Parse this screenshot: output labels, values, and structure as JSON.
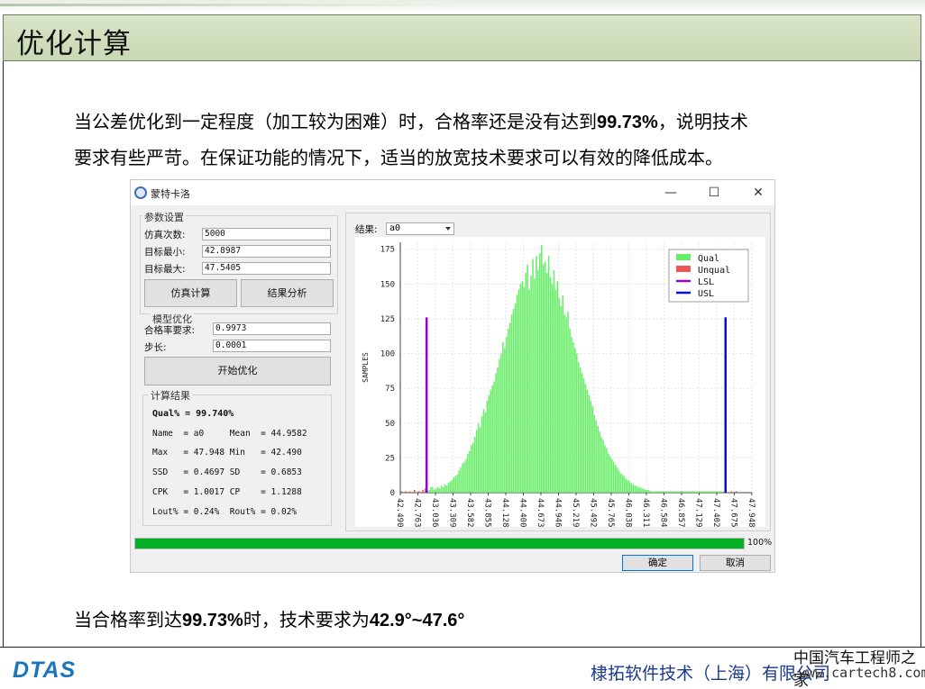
{
  "slide": {
    "title": "优化计算",
    "para1_line1_pre": "当公差优化到一定程度（加工较为困难）时，合格率还是没有达到",
    "para1_line1_bold": "99.73%",
    "para1_line1_post": "，说明技术",
    "para1_line2": "要求有些严苛。在保证功能的情况下，适当的放宽技术要求可以有效的降低成本。",
    "conc_pre": "当合格率到达",
    "conc_b1": "99.73%",
    "conc_mid": "时，技术要求为",
    "conc_b2": "42.9°~47.6°",
    "company": "棣拓软件技术（上海）有限公司",
    "logo": "DTAS",
    "watermark_line1": "中国汽车工程师之家",
    "watermark_line2": "www.cartech8.com"
  },
  "window": {
    "title": "蒙特卡洛",
    "minimize": "—",
    "maximize": "☐",
    "close": "✕",
    "params": {
      "group_label": "参数设置",
      "sim_count_label": "仿真次数:",
      "sim_count_value": "5000",
      "target_min_label": "目标最小:",
      "target_min_value": "42.8987",
      "target_max_label": "目标最大:",
      "target_max_value": "47.5405",
      "simulate_button": "仿真计算",
      "analyze_button": "结果分析"
    },
    "optimize": {
      "group_label": "模型优化",
      "qual_req_label": "合格率要求:",
      "qual_req_value": "0.9973",
      "step_label": "步长:",
      "step_value": "0.0001",
      "start_button": "开始优化"
    },
    "results": {
      "group_label": "计算结果",
      "qual_line": "Qual% = 99.740%",
      "rows": [
        "Name  = a0     Mean  = 44.9582",
        "Max   = 47.948 Min   = 42.490",
        "SSD   = 0.4697 SD    = 0.6853",
        "CPK   = 1.0017 CP    = 1.1288",
        "Lout% = 0.24%  Rout% = 0.02%"
      ]
    },
    "result_select_label": "结果:",
    "result_select_value": "a0",
    "progress": {
      "value": 1.0,
      "label": "100%"
    },
    "ok_button": "确定",
    "cancel_button": "取消"
  },
  "chart_data": {
    "type": "bar",
    "ylabel": "SAMPLES",
    "ylim": [
      0,
      180
    ],
    "yticks": [
      0,
      25,
      50,
      75,
      100,
      125,
      150,
      175
    ],
    "xlim": [
      42.49,
      47.95
    ],
    "xticks": [
      42.4906,
      42.7635,
      43.0364,
      43.3093,
      43.5822,
      43.8551,
      44.128,
      44.4009,
      44.6738,
      44.9467,
      45.2196,
      45.4925,
      45.7654,
      46.0383,
      46.3112,
      46.5841,
      46.857,
      47.1299,
      47.4028,
      47.6757,
      47.9486
    ],
    "xtick_labels": [
      "42.4906",
      "42.7635",
      "43.0364",
      "43.3093",
      "43.5822",
      "43.8551",
      "44.1280",
      "44.4009",
      "44.6738",
      "44.9467",
      "45.2196",
      "45.4925",
      "45.7654",
      "46.0383",
      "46.3112",
      "46.5841",
      "46.8570",
      "47.1299",
      "47.4028",
      "47.6757",
      "47.9486"
    ],
    "bin_width": 0.0273,
    "legend": {
      "position": "top-right",
      "entries": [
        "Qual",
        "Unqual",
        "LSL",
        "USL"
      ]
    },
    "lsl": 42.8987,
    "usl": 47.5405,
    "limit_height": 126,
    "colors": {
      "qual": "#66ee66",
      "unqual": "#ee5555",
      "lsl": "#9900cc",
      "usl": "#0011cc"
    },
    "series": [
      {
        "name": "Unqual",
        "x": [
          42.5,
          42.56,
          42.63,
          42.7,
          42.77,
          42.83,
          42.87,
          47.62,
          47.7
        ],
        "values": [
          1,
          1,
          1,
          2,
          1,
          2,
          3,
          1,
          1
        ]
      },
      {
        "name": "Qual",
        "x_start": 42.9,
        "values": [
          1,
          2,
          4,
          4,
          2,
          3,
          4,
          3,
          5,
          4,
          6,
          5,
          7,
          8,
          9,
          11,
          12,
          13,
          16,
          18,
          21,
          22,
          24,
          28,
          30,
          34,
          36,
          40,
          45,
          50,
          47,
          55,
          60,
          58,
          66,
          70,
          74,
          77,
          80,
          86,
          90,
          96,
          100,
          108,
          104,
          112,
          118,
          122,
          128,
          132,
          136,
          142,
          146,
          150,
          152,
          148,
          158,
          164,
          146,
          156,
          168,
          154,
          170,
          160,
          172,
          178,
          164,
          166,
          158,
          170,
          155,
          150,
          160,
          146,
          152,
          140,
          134,
          142,
          128,
          126,
          130,
          118,
          112,
          108,
          104,
          100,
          94,
          90,
          86,
          82,
          78,
          74,
          70,
          66,
          62,
          56,
          52,
          48,
          44,
          40,
          38,
          34,
          32,
          28,
          26,
          24,
          22,
          20,
          18,
          16,
          14,
          13,
          12,
          10,
          9,
          8,
          7,
          6,
          5,
          5,
          4,
          4,
          3,
          3,
          2,
          2,
          2,
          1,
          1,
          1,
          1,
          1,
          1,
          1,
          1,
          1,
          1,
          1,
          1,
          1,
          1,
          1,
          1,
          1,
          1,
          1,
          1,
          1,
          1,
          1,
          1,
          1,
          1,
          1,
          1,
          1,
          1,
          1,
          1,
          1,
          1,
          1,
          1,
          1,
          1,
          1,
          1,
          1
        ]
      }
    ]
  }
}
